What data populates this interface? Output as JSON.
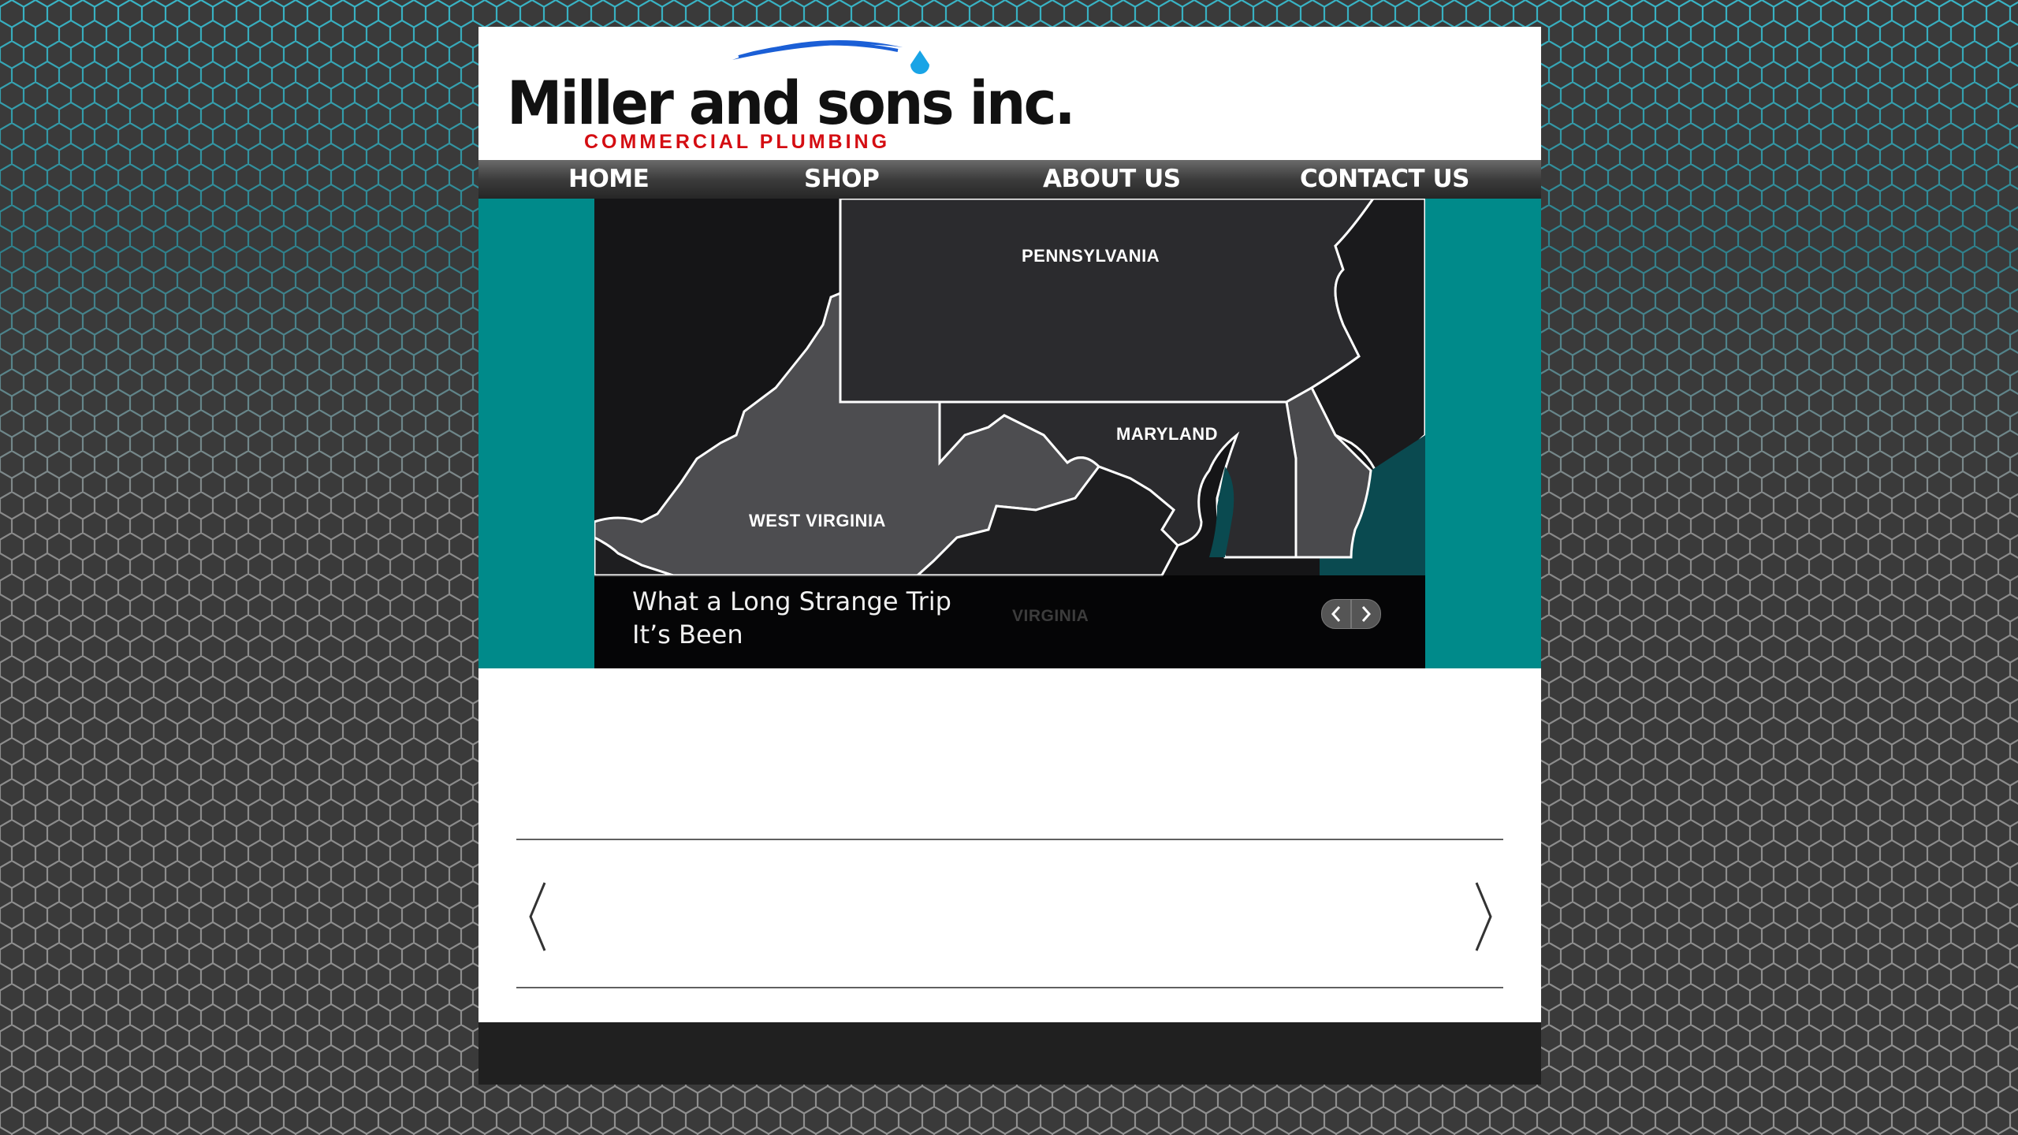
{
  "brand": {
    "name": "Miller and sons inc.",
    "tagline": "COMMERCIAL PLUMBING",
    "name_color": "#111111",
    "tagline_color": "#d40d12",
    "swoosh_color": "#1b5fd6"
  },
  "nav": {
    "items": [
      {
        "label": "HOME"
      },
      {
        "label": "SHOP"
      },
      {
        "label": "ABOUT US"
      },
      {
        "label": "CONTACT US"
      }
    ]
  },
  "hero": {
    "accent_color": "#008a8a",
    "map_labels": {
      "pennsylvania": "PENNSYLVANIA",
      "maryland": "MARYLAND",
      "west_virginia": "WEST VIRGINIA",
      "virginia": "VIRGINIA"
    },
    "caption": {
      "line1": "What a Long Strange Trip",
      "line2": "It’s Been"
    },
    "prev_icon": "chevron-left-icon",
    "next_icon": "chevron-right-icon"
  },
  "carousel": {
    "prev_icon": "angle-left-icon",
    "next_icon": "angle-right-icon"
  }
}
